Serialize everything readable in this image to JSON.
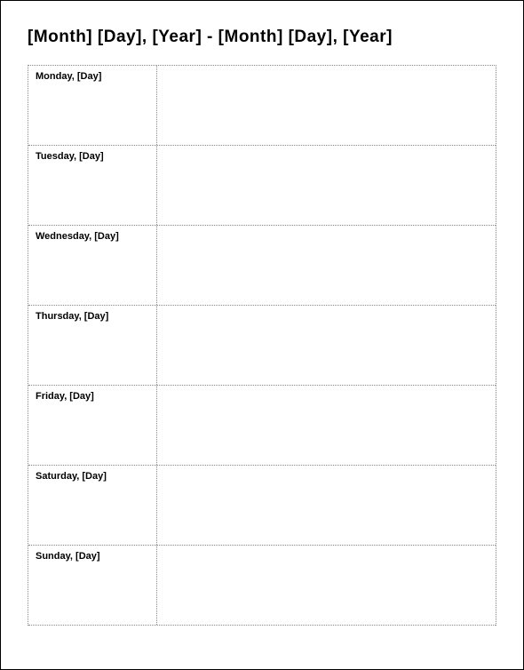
{
  "header": {
    "title": "[Month]  [Day], [Year] - [Month] [Day], [Year]"
  },
  "days": [
    {
      "label": "Monday, [Day]"
    },
    {
      "label": "Tuesday, [Day]"
    },
    {
      "label": "Wednesday, [Day]"
    },
    {
      "label": "Thursday, [Day]"
    },
    {
      "label": "Friday, [Day]"
    },
    {
      "label": "Saturday, [Day]"
    },
    {
      "label": "Sunday, [Day]"
    }
  ]
}
